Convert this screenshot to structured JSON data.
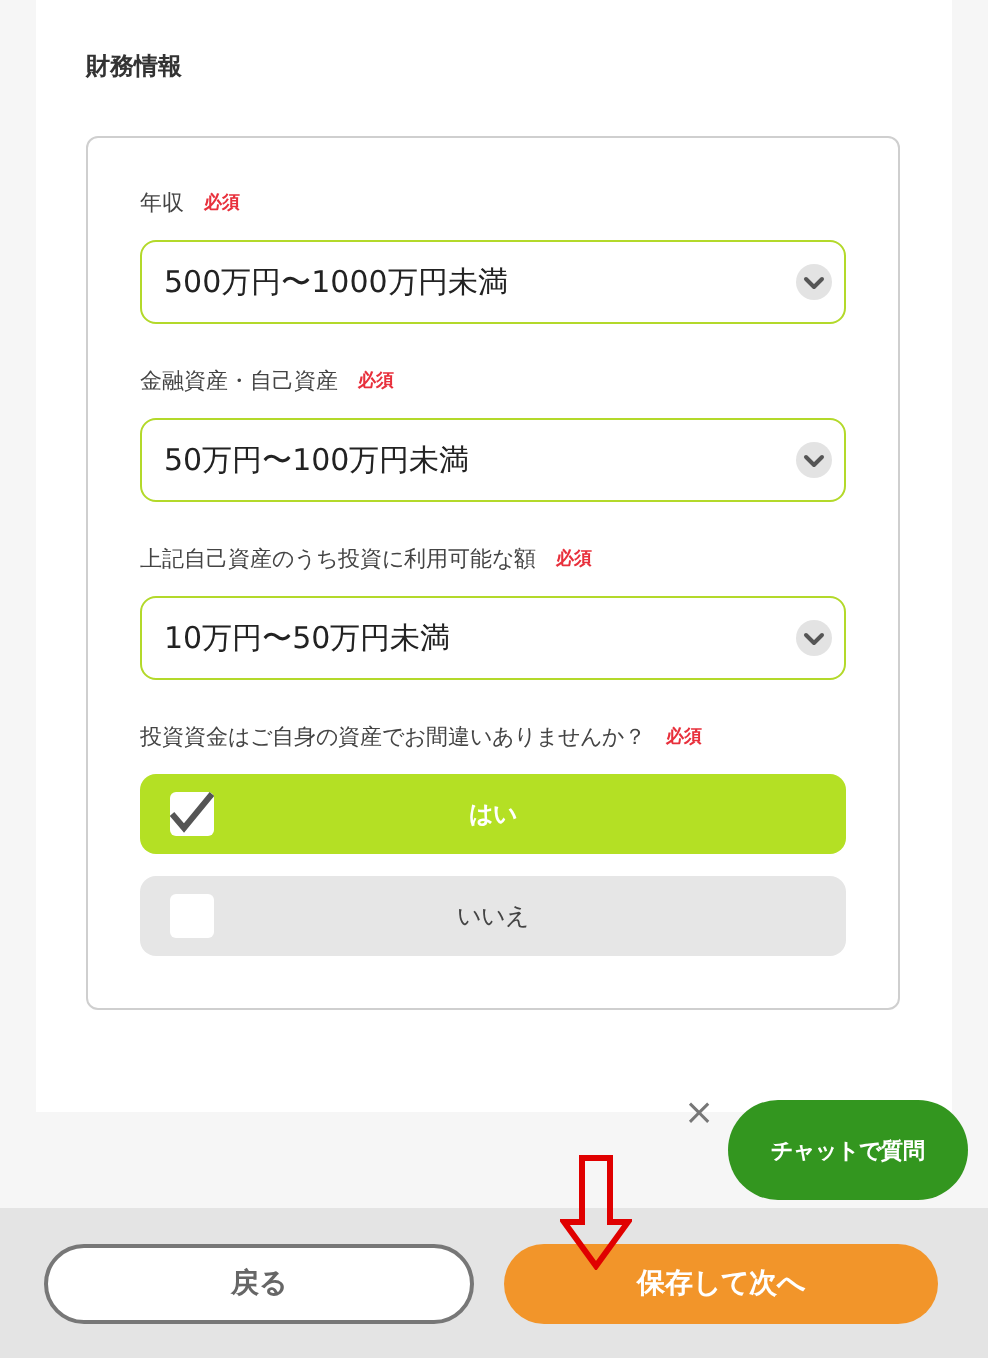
{
  "section_title": "財務情報",
  "fields": [
    {
      "label": "年収",
      "required": "必須",
      "value": "500万円〜1000万円未満"
    },
    {
      "label": "金融資産・自己資産",
      "required": "必須",
      "value": "50万円〜100万円未満"
    },
    {
      "label": "上記自己資産のうち投資に利用可能な額",
      "required": "必須",
      "value": "10万円〜50万円未満"
    }
  ],
  "question": {
    "label": "投資資金はご自身の資産でお間違いありませんか？",
    "required": "必須",
    "options": [
      {
        "label": "はい",
        "selected": true
      },
      {
        "label": "いいえ",
        "selected": false
      }
    ]
  },
  "chat": {
    "close": "×",
    "label": "チャットで質問"
  },
  "footer": {
    "back": "戻る",
    "next": "保存して次へ"
  }
}
